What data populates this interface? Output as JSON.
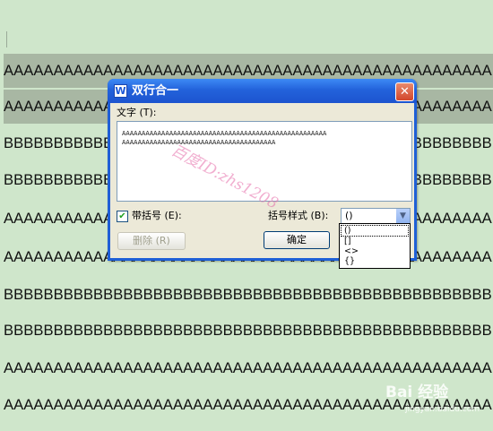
{
  "document": {
    "lines": [
      "AAAAAAAAAAAAAAAAAAAAAAAAAAAAAAAAAAAAAAAAAAAAAAAAA",
      "AAAAAAAAAAAAAAAAAAAAAAAAAAAAAAAAAAAAAAAAAAAAAAAAA",
      "BBBBBBBBBBBBBBBBBBBBBBBBBBBBBBBBBBBBBBBBBBBBBBBBB",
      "BBBBBBBBBBBBBBBBBBBBBBBBBBBBBBBBBBBBBBBBBBBBBBBBB",
      "AAAAAAAAAAAAAAAAAAAAAAAAAAAAAAAAAAAAAAAAAAAAAAAAA",
      "AAAAAAAAAAAAAAAAAAAAAAAAAAAAAAAAAAAAAAAAAAAAAAAAA",
      "BBBBBBBBBBBBBBBBBBBBBBBBBBBBBBBBBBBBBBBBBBBBBBBBB",
      "BBBBBBBBBBBBBBBBBBBBBBBBBBBBBBBBBBBBBBBBBBBBBBBBB",
      "AAAAAAAAAAAAAAAAAAAAAAAAAAAAAAAAAAAAAAAAAAAAAAAAA",
      "AAAAAAAAAAAAAAAAAAAAAAAAAAAAAAAAAAAAAAAAAAAAAAAAA"
    ]
  },
  "dialog": {
    "icon": "W",
    "title": "双行合一",
    "close_glyph": "✕",
    "text_label": "文字 (T):",
    "text_line1": "AAAAAAAAAAAAAAAAAAAAAAAAAAAAAAAAAAAAAAAAAAAAAAAAAAAA",
    "text_line2": "AAAAAAAAAAAAAAAAAAAAAAAAAAAAAAAAAAAAAAA",
    "bracket_checkbox_label": "带括号 (E):",
    "bracket_checked": true,
    "bracket_style_label": "括号样式 (B):",
    "bracket_style_value": "()",
    "bracket_options": [
      "()",
      "[]",
      "<>",
      "{}"
    ],
    "delete_button": "删除 (R)",
    "ok_button": "确定"
  },
  "watermark": "百度ID:zhs1208",
  "brand": {
    "logo_text": "Bai 经验",
    "url": "jingyan.baidu.com"
  },
  "colors": {
    "doc_bg": "#cfe6cb",
    "selection": "#a8b7a3",
    "titlebar": "#2362db",
    "close": "#d2462b"
  }
}
